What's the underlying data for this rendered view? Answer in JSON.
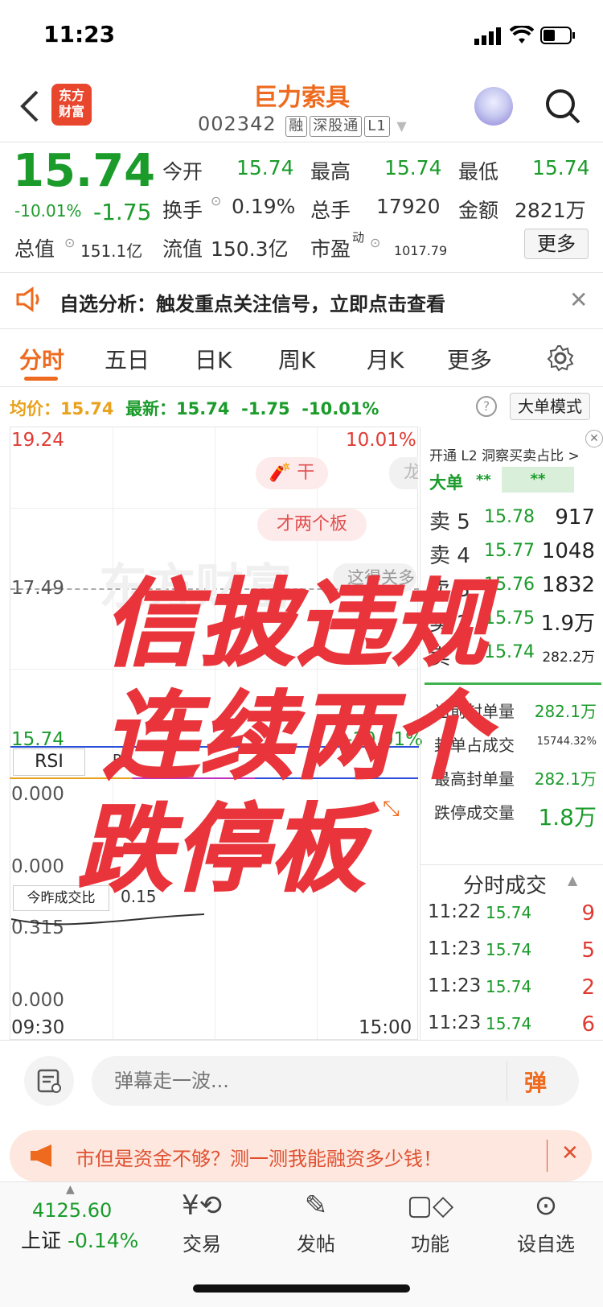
{
  "status_bar": {
    "time": "11:23"
  },
  "header": {
    "title": "巨力索具",
    "code": "002342",
    "tags": [
      "融",
      "深股通",
      "L1"
    ],
    "logo_text": "东方\n财富"
  },
  "quote": {
    "price": "15.74",
    "change_pct": "-10.01%",
    "change": "-1.75",
    "total_value_label": "总值",
    "total_value": "151.1亿",
    "stats": [
      {
        "label": "今开",
        "value": "15.74"
      },
      {
        "label": "最高",
        "value": "15.74"
      },
      {
        "label": "最低",
        "value": "15.74"
      },
      {
        "label": "换手",
        "value": "0.19%"
      },
      {
        "label": "总手",
        "value": "17920"
      },
      {
        "label": "金额",
        "value": "2821万"
      },
      {
        "label": "流值",
        "value": "150.3亿"
      },
      {
        "label": "市盈",
        "value": "1017.79"
      }
    ],
    "pe_superscript": "动",
    "more_button": "更多"
  },
  "notice": {
    "text": "自选分析：触发重点关注信号，立即点击查看"
  },
  "tabs": [
    "分时",
    "五日",
    "日K",
    "周K",
    "月K",
    "更多"
  ],
  "avg_bar": {
    "avg_label": "均价：",
    "avg_value": "15.74",
    "latest_label": "最新：",
    "latest_value": "15.74",
    "change": "-1.75",
    "change_pct": "-10.01%",
    "mode_button": "大单模式"
  },
  "chart": {
    "y_top": "19.24",
    "y_top_pct": "10.01%",
    "y_mid": "17.49",
    "y_bottom": "15.74",
    "y_bottom_pct": "-10.01%",
    "danmaku": [
      "干",
      "才两个板",
      "这得关多",
      "龙"
    ],
    "watermark": "东方财富",
    "rsi_label": "RSI",
    "rsi_value_partial": "RS",
    "rsi_top": "0.000",
    "rsi_bottom": "0.000",
    "vol_label": "今昨成交比",
    "vol_value": "0.15",
    "vol_top": "0.315",
    "vol_bottom": "0.000",
    "time_start": "09:30",
    "time_end": "15:00"
  },
  "overlay_text": [
    "信披违规",
    "连续两个",
    "跌停板"
  ],
  "l2": {
    "promo": "开通 L2 洞察买卖占比 >",
    "big_order": "大单",
    "stars1": "**",
    "stars2": "**"
  },
  "order_book": [
    {
      "label": "卖 5",
      "price": "15.78",
      "vol": "917"
    },
    {
      "label": "卖 4",
      "price": "15.77",
      "vol": "1048"
    },
    {
      "label": "卖 3",
      "price": "15.76",
      "vol": "1832"
    },
    {
      "label": "卖 2",
      "price": "15.75",
      "vol": "1.9万"
    },
    {
      "label": "卖 1",
      "price": "15.74",
      "vol": "282.2万"
    }
  ],
  "seal_stats": [
    {
      "label": "当前封单量",
      "value": "282.1万"
    },
    {
      "label": "封单占成交",
      "value": "15744.32%"
    },
    {
      "label": "最高封单量",
      "value": "282.1万"
    },
    {
      "label": "跌停成交量",
      "value": "1.8万"
    }
  ],
  "ticks_title": "分时成交",
  "ticks": [
    {
      "time": "11:22",
      "price": "15.74",
      "vol": "9"
    },
    {
      "time": "11:23",
      "price": "15.74",
      "vol": "5"
    },
    {
      "time": "11:23",
      "price": "15.74",
      "vol": "2"
    },
    {
      "time": "11:23",
      "price": "15.74",
      "vol": "6"
    }
  ],
  "comment": {
    "placeholder": "弹幕走一波...",
    "send": "弹"
  },
  "ad": {
    "text": "市但是资金不够？测一测我能融资多少钱！"
  },
  "bottom_nav": {
    "index_value": "4125.60",
    "index_name": "上证",
    "index_change": "-0.14%",
    "items": [
      "交易",
      "发帖",
      "功能",
      "设自选"
    ]
  }
}
